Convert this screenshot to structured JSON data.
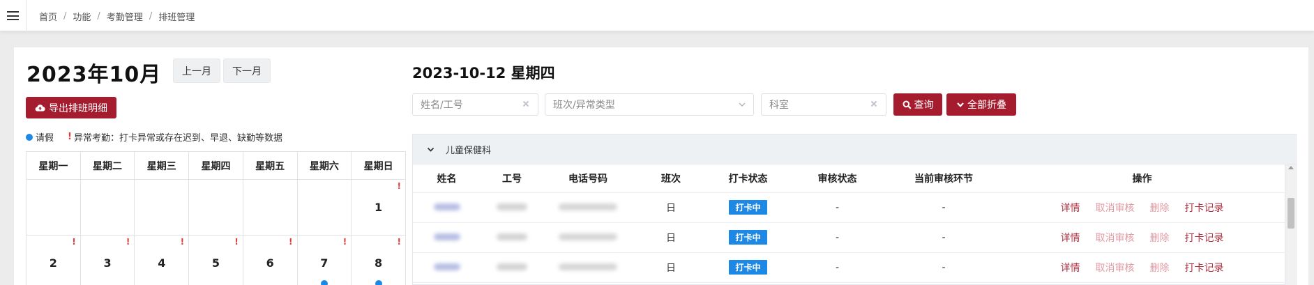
{
  "breadcrumb": [
    "首页",
    "功能",
    "考勤管理",
    "排班管理"
  ],
  "calendar": {
    "month_title": "2023年10月",
    "prev_label": "上一月",
    "next_label": "下一月",
    "export_label": "导出排班明细",
    "legend_leave": "请假",
    "legend_abnormal": "异常考勤：打卡异常或存在迟到、早退、缺勤等数据",
    "weekdays": [
      "星期一",
      "星期二",
      "星期三",
      "星期四",
      "星期五",
      "星期六",
      "星期日"
    ],
    "week1": [
      "",
      "",
      "",
      "",
      "",
      "",
      "1"
    ],
    "week2": [
      "2",
      "3",
      "4",
      "5",
      "6",
      "7",
      "8"
    ],
    "warn_mark": "!"
  },
  "detail": {
    "date_title": "2023-10-12 星期四",
    "filters": {
      "name_placeholder": "姓名/工号",
      "shift_placeholder": "班次/异常类型",
      "dept_placeholder": "科室"
    },
    "query_label": "查询",
    "collapse_label": "全部折叠",
    "dept_name": "儿童保健科",
    "columns": [
      "姓名",
      "工号",
      "电话号码",
      "班次",
      "打卡状态",
      "审核状态",
      "当前审核环节",
      "操作"
    ],
    "rows": [
      {
        "shift": "日",
        "punch_status": "打卡中",
        "review_status": "-",
        "review_step": "-"
      },
      {
        "shift": "日",
        "punch_status": "打卡中",
        "review_status": "-",
        "review_step": "-"
      },
      {
        "shift": "日",
        "punch_status": "打卡中",
        "review_status": "-",
        "review_step": "-"
      }
    ],
    "actions": {
      "detail": "详情",
      "cancel_review": "取消审核",
      "delete": "删除",
      "punch_records": "打卡记录"
    }
  },
  "colors": {
    "primary": "#a61c2f",
    "leave_dot": "#1e88e5",
    "warn": "#e53935",
    "badge": "#1e88e5"
  },
  "icons": {
    "menu": "hamburger-icon",
    "export": "cloud-upload-icon",
    "query": "search-icon",
    "collapse": "chevron-down-icon",
    "clear": "close-icon"
  }
}
